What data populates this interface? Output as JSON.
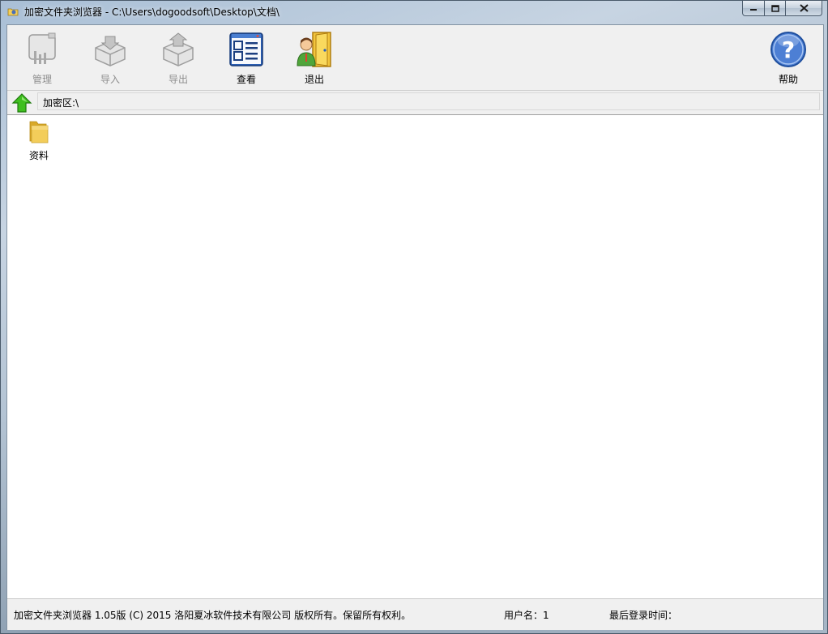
{
  "window": {
    "title": "加密文件夹浏览器 - C:\\Users\\dogoodsoft\\Desktop\\文档\\"
  },
  "toolbar": {
    "items": [
      {
        "label": "管理",
        "icon": "manage-icon",
        "enabled": false
      },
      {
        "label": "导入",
        "icon": "import-icon",
        "enabled": false
      },
      {
        "label": "导出",
        "icon": "export-icon",
        "enabled": false
      },
      {
        "label": "查看",
        "icon": "view-icon",
        "enabled": true
      },
      {
        "label": "退出",
        "icon": "exit-door-icon",
        "enabled": true
      }
    ],
    "help_label": "帮助"
  },
  "address": {
    "path": "加密区:\\"
  },
  "files": [
    {
      "name": "资料",
      "icon": "folder-icon"
    }
  ],
  "status": {
    "copyright": "加密文件夹浏览器 1.05版 (C) 2015 洛阳夏冰软件技术有限公司 版权所有。保留所有权利。",
    "username": "用户名：1",
    "last_login": "最后登录时间："
  },
  "colors": {
    "accent_blue": "#2b5fb4",
    "up_arrow_green": "#3fbf1f",
    "folder_yellow": "#f3cd5a"
  }
}
